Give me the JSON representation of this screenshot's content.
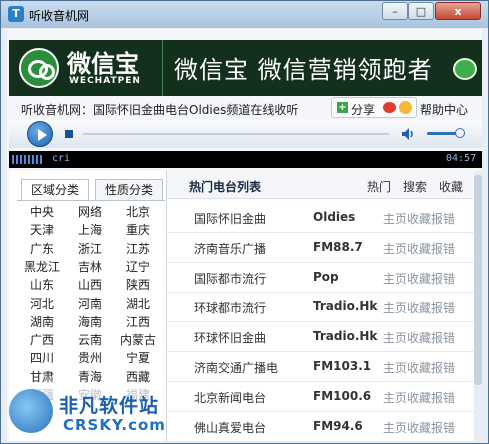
{
  "window": {
    "icon_glyph": "T",
    "title": "听收音机网",
    "min_glyph": "–",
    "max_glyph": "□",
    "close_glyph": "x"
  },
  "banner": {
    "logo_cn": "微信宝",
    "logo_en": "WECHATPEN",
    "slogan": "微信宝  微信营销领跑者"
  },
  "status": {
    "now_playing": "听收音机网：国际怀旧金曲电台Oldies频道在线收听",
    "share_label": "分享",
    "help_label": "帮助中心"
  },
  "player": {
    "lcd_text": "cri",
    "time": "04:57",
    "volume_level": 0.75
  },
  "left_panel": {
    "tabs": [
      "区域分类",
      "性质分类"
    ],
    "regions": [
      [
        "中央",
        "网络",
        "北京"
      ],
      [
        "天津",
        "上海",
        "重庆"
      ],
      [
        "广东",
        "浙江",
        "江苏"
      ],
      [
        "黑龙江",
        "吉林",
        "辽宁"
      ],
      [
        "山东",
        "山西",
        "陕西"
      ],
      [
        "河北",
        "河南",
        "湖北"
      ],
      [
        "湖南",
        "海南",
        "江西"
      ],
      [
        "广西",
        "云南",
        "内蒙古"
      ],
      [
        "四川",
        "贵州",
        "宁夏"
      ],
      [
        "甘肃",
        "青海",
        "西藏"
      ],
      [
        "新疆",
        "安徽",
        "福建"
      ]
    ]
  },
  "right_panel": {
    "title": "热门电台列表",
    "tabs": [
      "热门",
      "搜索",
      "收藏"
    ],
    "actions": [
      "主页",
      "收藏",
      "报错"
    ],
    "stations": [
      {
        "name": "国际怀旧金曲",
        "freq": "Oldies"
      },
      {
        "name": "济南音乐广播",
        "freq": "FM88.7"
      },
      {
        "name": "国际都市流行",
        "freq": "Pop"
      },
      {
        "name": "环球都市流行",
        "freq": "Tradio.Hk"
      },
      {
        "name": "环球怀旧金曲",
        "freq": "Tradio.Hk"
      },
      {
        "name": "济南交通广播电",
        "freq": "FM103.1"
      },
      {
        "name": "北京新闻电台",
        "freq": "FM100.6"
      },
      {
        "name": "佛山真爱电台",
        "freq": "FM94.6"
      }
    ]
  },
  "watermark": {
    "cn": "非凡软件站",
    "en": "CRSKY.com"
  }
}
